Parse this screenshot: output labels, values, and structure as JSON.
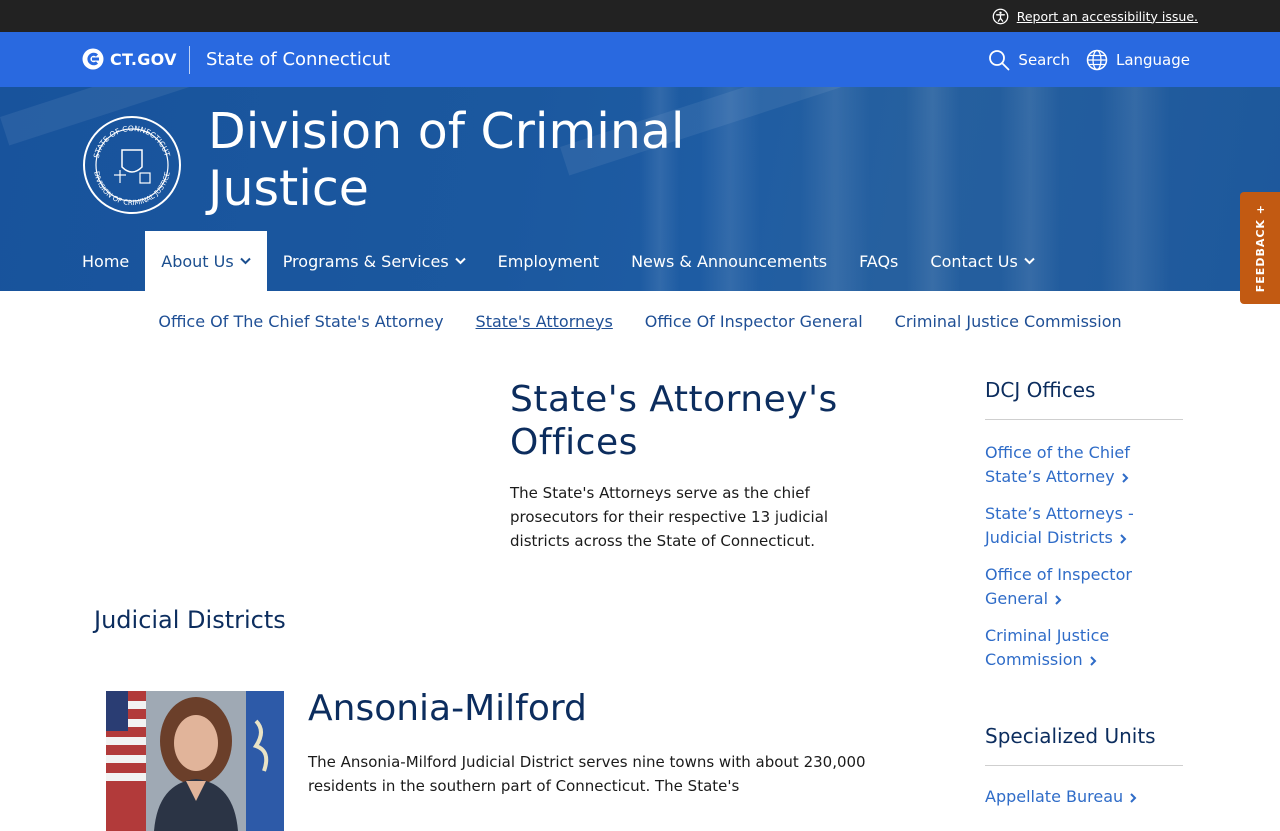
{
  "utility": {
    "accessibility_link": "Report an accessibility issue."
  },
  "site": {
    "logo_text": "CT.GOV",
    "state_name": "State of Connecticut",
    "search_label": "Search",
    "language_label": "Language"
  },
  "hero": {
    "title": "Division of Criminal Justice"
  },
  "mainnav": [
    {
      "label": "Home",
      "dropdown": false,
      "active": false
    },
    {
      "label": "About Us",
      "dropdown": true,
      "active": true
    },
    {
      "label": "Programs & Services",
      "dropdown": true,
      "active": false
    },
    {
      "label": "Employment",
      "dropdown": false,
      "active": false
    },
    {
      "label": "News & Announcements",
      "dropdown": false,
      "active": false
    },
    {
      "label": "FAQs",
      "dropdown": false,
      "active": false
    },
    {
      "label": "Contact Us",
      "dropdown": true,
      "active": false
    }
  ],
  "subnav": [
    {
      "label": "Office Of The Chief State's Attorney"
    },
    {
      "label": "State's Attorneys"
    },
    {
      "label": "Office Of Inspector General"
    },
    {
      "label": "Criminal Justice Commission"
    }
  ],
  "feedback_label": "FEEDBACK +",
  "main": {
    "title_line1": "State's Attorney's",
    "title_line2": "Offices",
    "intro": "The State's Attorneys serve as the chief prosecutors for their respective 13 judicial districts across the State of Connecticut.",
    "section_title": "Judicial Districts",
    "district": {
      "name": "Ansonia-Milford",
      "description": "The Ansonia-Milford Judicial District serves nine towns with about 230,000 residents in the southern part of Connecticut. The State's"
    }
  },
  "sidebar": {
    "offices_heading": "DCJ Offices",
    "offices": [
      "Office of the Chief State’s Attorney",
      "State’s Attorneys - Judicial Districts",
      "Office of Inspector General",
      "Criminal Justice Commission"
    ],
    "units_heading": "Specialized Units",
    "units": [
      "Appellate Bureau"
    ]
  },
  "colors": {
    "brand_blue": "#2969e0",
    "hero_blue": "#1b589f",
    "link": "#2f6cc8",
    "feedback": "#c25a12"
  }
}
